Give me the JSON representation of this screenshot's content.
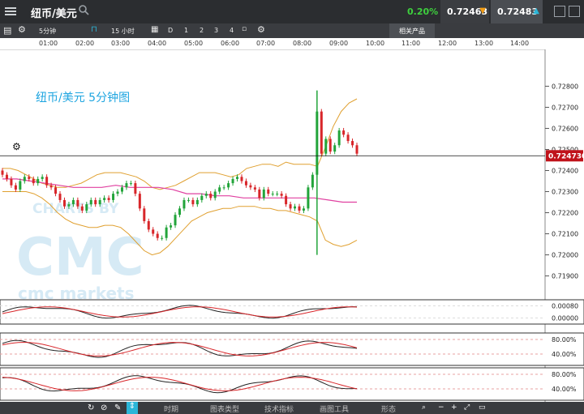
{
  "header": {
    "pair": "纽币/美元",
    "change": "0.20%",
    "sell_price": "0.72463",
    "buy_price": "0.72483",
    "icons": [
      "menu-icon",
      "search-icon",
      "arrow-down-icon",
      "arrow-up-icon",
      "minimize-icon",
      "restore-icon",
      "close-icon"
    ]
  },
  "toolbar": {
    "timeframe": "5分钟",
    "range": "15 小时",
    "draw_label": "D",
    "n1": "1",
    "n2": "2",
    "n3": "3",
    "n4": "4",
    "related_products": "相关产品"
  },
  "time_axis": [
    "01:00",
    "02:00",
    "03:00",
    "04:00",
    "05:00",
    "06:00",
    "07:00",
    "08:00",
    "09:00",
    "10:00",
    "11:00",
    "12:00",
    "13:00",
    "14:00"
  ],
  "chart_data": {
    "type": "candlestick",
    "title": "纽币/美元 5分钟图",
    "watermark": [
      "CHARTS BY",
      "cmc markets"
    ],
    "y_ticks": [
      "0.72800",
      "0.72700",
      "0.72600",
      "0.72500",
      "0.72400",
      "0.72300",
      "0.72200",
      "0.72100",
      "0.72000",
      "0.71900"
    ],
    "ylim": [
      0.7186,
      0.7289
    ],
    "current_price": "0.724730",
    "current_value": 0.7247,
    "closes": [
      0.7238,
      0.7236,
      0.7233,
      0.7231,
      0.7235,
      0.7237,
      0.7236,
      0.7234,
      0.7236,
      0.7237,
      0.7233,
      0.7232,
      0.7229,
      0.7226,
      0.7223,
      0.7224,
      0.7226,
      0.7223,
      0.7221,
      0.7224,
      0.7226,
      0.7224,
      0.7226,
      0.7227,
      0.7226,
      0.7229,
      0.723,
      0.7232,
      0.7234,
      0.7234,
      0.7229,
      0.7222,
      0.7216,
      0.7212,
      0.721,
      0.7208,
      0.7208,
      0.7213,
      0.7214,
      0.7219,
      0.7222,
      0.7226,
      0.7226,
      0.7224,
      0.7226,
      0.7228,
      0.7229,
      0.7227,
      0.723,
      0.7232,
      0.7232,
      0.7234,
      0.7236,
      0.7237,
      0.7235,
      0.7233,
      0.7232,
      0.7231,
      0.7227,
      0.7231,
      0.7229,
      0.7229,
      0.7229,
      0.7228,
      0.7224,
      0.7222,
      0.7223,
      0.7221,
      0.7222,
      0.7232,
      0.7238,
      0.7268,
      0.7248,
      0.7255,
      0.7249,
      0.7252,
      0.7259,
      0.7257,
      0.7254,
      0.7252,
      0.7248
    ],
    "bands": {
      "upper": [
        0.7241,
        0.7241,
        0.724,
        0.7238,
        0.7236,
        0.7234,
        0.7233,
        0.7232,
        0.7232,
        0.7233,
        0.7234,
        0.7236,
        0.7238,
        0.7239,
        0.7239,
        0.7239,
        0.7238,
        0.7237,
        0.7235,
        0.7232,
        0.7231,
        0.7232,
        0.7233,
        0.7235,
        0.7237,
        0.7239,
        0.7239,
        0.7239,
        0.7238,
        0.7237,
        0.7238,
        0.7241,
        0.7242,
        0.7243,
        0.7243,
        0.7242,
        0.7244,
        0.7243,
        0.7243,
        0.7243,
        0.7242,
        0.7251,
        0.7261,
        0.7268,
        0.7272,
        0.7274
      ],
      "lower": [
        0.723,
        0.723,
        0.723,
        0.723,
        0.7229,
        0.7227,
        0.7224,
        0.722,
        0.7217,
        0.7215,
        0.7214,
        0.7213,
        0.7213,
        0.7214,
        0.7214,
        0.7213,
        0.721,
        0.7206,
        0.7202,
        0.72,
        0.7201,
        0.7204,
        0.7208,
        0.7212,
        0.7216,
        0.7218,
        0.722,
        0.7221,
        0.7222,
        0.7222,
        0.7223,
        0.7223,
        0.7223,
        0.7222,
        0.7222,
        0.7221,
        0.7221,
        0.722,
        0.7219,
        0.7218,
        0.7216,
        0.7207,
        0.7205,
        0.7204,
        0.7205,
        0.7207
      ]
    },
    "ma": [
      0.7236,
      0.7236,
      0.7235,
      0.7234,
      0.7233,
      0.7232,
      0.7232,
      0.7232,
      0.7233,
      0.7232,
      0.7232,
      0.7232,
      0.7231,
      0.7229,
      0.7229,
      0.7228,
      0.7228,
      0.7227,
      0.7227,
      0.7227,
      0.7227,
      0.7227,
      0.7227,
      0.7226,
      0.7225,
      0.7225
    ],
    "macd_ticks": [
      "0.00080",
      "0.00000"
    ],
    "rsi_ticks": [
      "80.00%",
      "40.00%"
    ],
    "stoch_ticks": [
      "80.00%",
      "40.00%"
    ]
  },
  "bottom": {
    "period": "时期",
    "chart_type": "图表类型",
    "indicators": "技术指标",
    "draw_tools": "画图工具",
    "patterns": "形态"
  }
}
